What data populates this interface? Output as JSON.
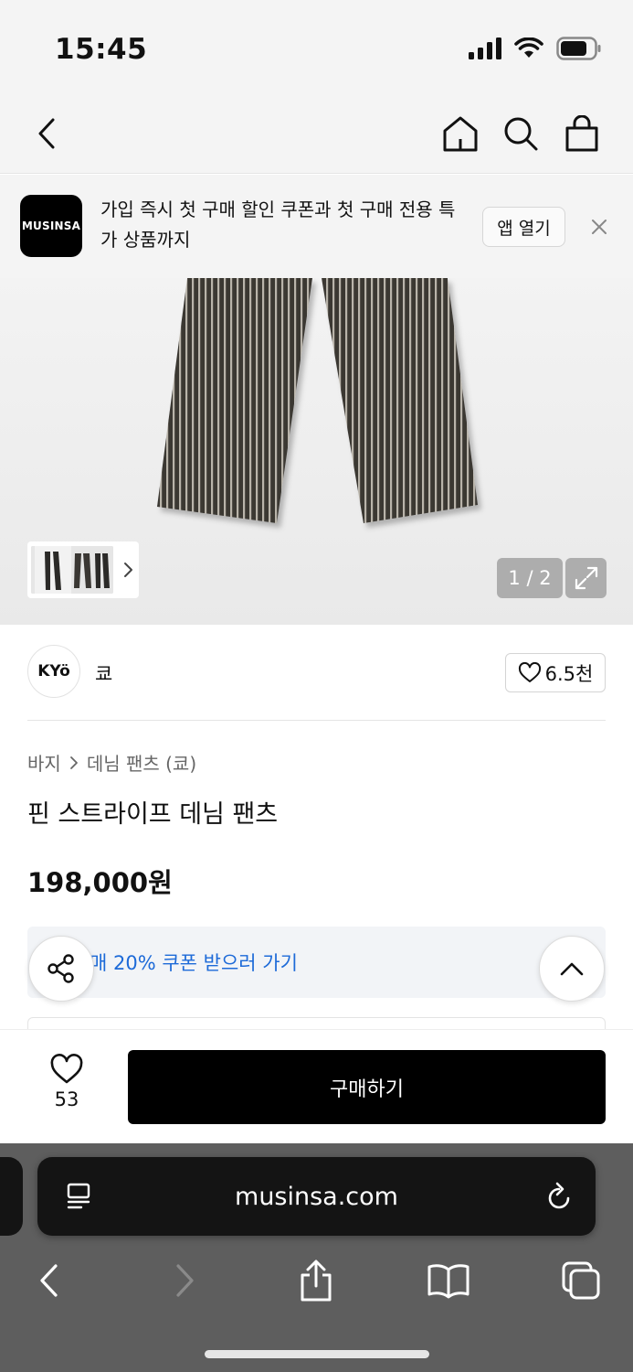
{
  "status_bar": {
    "time": "15:45"
  },
  "nav": {
    "back_icon": "chevron-left-icon",
    "home_icon": "home-icon",
    "search_icon": "search-icon",
    "bag_icon": "shopping-bag-icon"
  },
  "app_banner": {
    "logo_text": "MUSINSA",
    "message": "가입 즉시 첫 구매 할인 쿠폰과 첫 구매 전용 특가 상품까지",
    "open_label": "앱 열기"
  },
  "gallery": {
    "counter": "1 / 2"
  },
  "brand": {
    "logo_text": "KYö",
    "name": "쿄",
    "likes": "6.5천"
  },
  "product": {
    "breadcrumb": [
      "바지",
      "데님 팬츠 (쿄)"
    ],
    "title": "핀 스트라이프 데님 팬츠",
    "price": "198,000원",
    "coupon_text": "매 20% 쿠폰 받으러 가기"
  },
  "purchase": {
    "like_count": "53",
    "buy_label": "구매하기"
  },
  "browser": {
    "url": "musinsa.com"
  },
  "colors": {
    "coupon_blue": "#1d6ad8",
    "buy_black": "#000000",
    "safari_gray": "#5e5e5e"
  }
}
